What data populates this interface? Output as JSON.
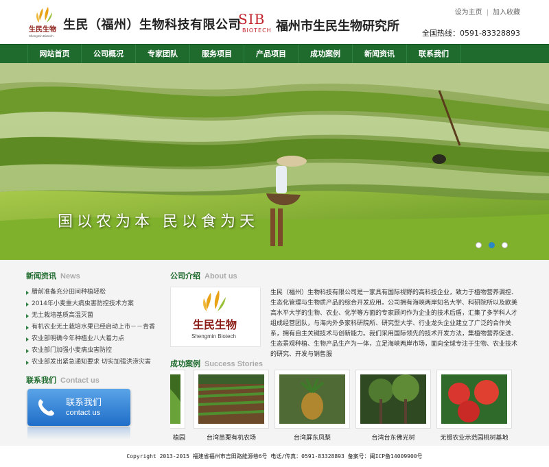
{
  "header": {
    "company_name": "生民（福州）生物科技有限公司",
    "logo_cn": "生民生物",
    "logo_en": "Shengmin Biotech",
    "sib_text": "SIB",
    "sib_sub": "BIOTECH",
    "institute_name": "福州市生民生物研究所",
    "set_home": "设为主页",
    "add_favorite": "加入收藏",
    "separator": "|",
    "hotline": "全国热线：0591-83328893"
  },
  "nav": {
    "items": [
      {
        "label": "网站首页"
      },
      {
        "label": "公司概况"
      },
      {
        "label": "专家团队"
      },
      {
        "label": "服务项目"
      },
      {
        "label": "产品项目"
      },
      {
        "label": "成功案例"
      },
      {
        "label": "新闻资讯"
      },
      {
        "label": "联系我们"
      }
    ]
  },
  "banner": {
    "slogan": "国以农为本  民以食为天",
    "slides": 3,
    "active_slide": 2
  },
  "news": {
    "title_cn": "新闻资讯",
    "title_en": "News",
    "items": [
      "腊前准备充分田间种植轻松",
      "2014年小麦重大病虫害防控技术方案",
      "无土栽培基质高温灭菌",
      "有机农业无土栽培水果已经启动上市－－青香",
      "农业部明确今年种植业八大着力点",
      "农业部门加强小麦病虫害防控",
      "农业部发出紧急通知要求 切实加强洪涝灾害"
    ]
  },
  "contact": {
    "title_cn": "联系我们",
    "title_en": "Contact us",
    "button_cn": "联系我们",
    "button_en": "contact us"
  },
  "about": {
    "title_cn": "公司介绍",
    "title_en": "About us",
    "logo_cn": "生民生物",
    "logo_en": "Shengmin Biotech",
    "text": "生民（福州）生物科技有限公司是一家具有国际视野的高科技企业，致力于植物营养调控、生态化管理与生物质产品的综合开发应用。公司拥有海峡两岸知名大学、科研院所以及欧美高水平大学的生物、农业、化学等方面的专家顾问作为企业的技术后盾，汇集了多学科人才组成经营团队，与海内外多家科研院所、研究型大学、行业龙头企业建立了广泛的合作关系，拥有自主关键技术与创新能力。我们采用国际领先的技术开发方法，集植物营养促进、生态景观种植、生物产品生产为一体，立足海峡两岸市场，面向全球专注于生物、农业技术的研究、开发与销售服"
  },
  "cases": {
    "title_cn": "成功案例",
    "title_en": "Success Stories",
    "items": [
      {
        "caption": "植园"
      },
      {
        "caption": "台湾苗栗有机农场"
      },
      {
        "caption": "台湾屏东凤梨"
      },
      {
        "caption": "台湾台东佛光树"
      },
      {
        "caption": "无锡农业示范园桃树基地"
      }
    ]
  },
  "footer": {
    "text": "Copyright 2013-2015 福建省福州市吉田路能源巷6号 电话/传真：0591-83328893 备案号：闽ICP备14009900号"
  },
  "colors": {
    "nav_green": "#1e6b2d",
    "title_green": "#1e6b2d",
    "brand_red": "#c0212a",
    "contact_blue": "#1f6ec8"
  }
}
